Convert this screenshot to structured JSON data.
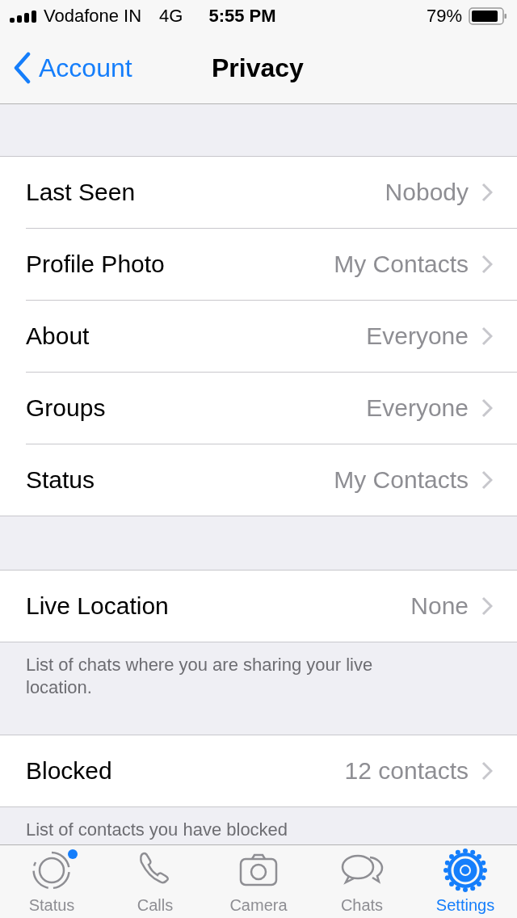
{
  "status_bar": {
    "carrier": "Vodafone IN",
    "network": "4G",
    "time": "5:55 PM",
    "battery": "79%"
  },
  "nav": {
    "back": "Account",
    "title": "Privacy"
  },
  "sections": [
    {
      "rows": [
        {
          "label": "Last Seen",
          "value": "Nobody"
        },
        {
          "label": "Profile Photo",
          "value": "My Contacts"
        },
        {
          "label": "About",
          "value": "Everyone"
        },
        {
          "label": "Groups",
          "value": "Everyone"
        },
        {
          "label": "Status",
          "value": "My Contacts"
        }
      ]
    },
    {
      "rows": [
        {
          "label": "Live Location",
          "value": "None"
        }
      ],
      "footer": "List of chats where you are sharing your live location."
    },
    {
      "rows": [
        {
          "label": "Blocked",
          "value": "12 contacts"
        }
      ],
      "footer": "List of contacts you have blocked"
    }
  ],
  "tabs": [
    {
      "kind": "status",
      "label": "Status",
      "selected": false,
      "badge": true
    },
    {
      "kind": "calls",
      "label": "Calls",
      "selected": false,
      "badge": false
    },
    {
      "kind": "camera",
      "label": "Camera",
      "selected": false,
      "badge": false
    },
    {
      "kind": "chats",
      "label": "Chats",
      "selected": false,
      "badge": false
    },
    {
      "kind": "settings",
      "label": "Settings",
      "selected": true,
      "badge": false
    }
  ]
}
